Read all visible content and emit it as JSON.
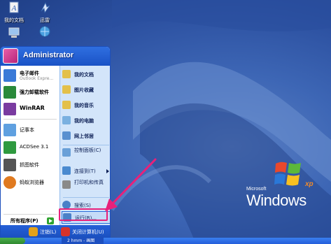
{
  "desktop": {
    "icons": [
      {
        "label": "我的文档",
        "icon": "my-documents-icon"
      },
      {
        "label": "迅雷",
        "icon": "thunder-icon"
      },
      {
        "label": "",
        "icon": "my-computer-icon"
      },
      {
        "label": "",
        "icon": "network-places-icon"
      }
    ],
    "logo": {
      "small_text": "Microsoft",
      "main_text": "Windows",
      "xp_text": "xp"
    }
  },
  "start_menu": {
    "user_name": "Administrator",
    "left_items": [
      {
        "title": "电子邮件",
        "subtitle": "Outlook Expre...",
        "icon": "email-icon",
        "color": "#3a7ad8"
      },
      {
        "title": "强力卸载软件",
        "subtitle": "",
        "icon": "uninstaller-icon",
        "color": "#2a8a3a"
      },
      {
        "title": "WinRAR",
        "subtitle": "",
        "icon": "winrar-icon",
        "color": "#7a3ba0"
      },
      {
        "title": "记事本",
        "subtitle": "",
        "icon": "notepad-icon",
        "color": "#5fa0e0"
      },
      {
        "title": "ACDSee 3.1",
        "subtitle": "",
        "icon": "acdsee-icon",
        "color": "#2f9a3f"
      },
      {
        "title": "抓图软件",
        "subtitle": "",
        "icon": "camera-icon",
        "color": "#555555"
      },
      {
        "title": "蚂蚁浏览器",
        "subtitle": "",
        "icon": "browser-icon",
        "color": "#e07a20"
      }
    ],
    "all_programs": "所有程序(P)",
    "right_items": [
      {
        "label": "我的文档",
        "icon": "my-documents-icon",
        "color": "#e3c04a",
        "bold": true
      },
      {
        "label": "图片收藏",
        "icon": "my-pictures-icon",
        "color": "#e3c04a",
        "bold": true
      },
      {
        "label": "我的音乐",
        "icon": "my-music-icon",
        "color": "#e3c04a",
        "bold": true
      },
      {
        "label": "我的电脑",
        "icon": "my-computer-icon",
        "color": "#7ab0e0",
        "bold": true
      },
      {
        "label": "网上邻居",
        "icon": "network-places-icon",
        "color": "#5a90d0",
        "bold": true
      },
      {
        "label": "控制面板(C)",
        "icon": "control-panel-icon",
        "color": "#6aa0d8",
        "bold": false
      },
      {
        "label": "连接到(T)",
        "icon": "connect-to-icon",
        "color": "#4a8ad0",
        "bold": false
      },
      {
        "label": "打印机和传真",
        "icon": "printer-icon",
        "color": "#8a8a8a",
        "bold": false
      },
      {
        "label": "搜索(S)",
        "icon": "search-icon",
        "color": "#4a80c8",
        "bold": false
      },
      {
        "label": "运行(R)...",
        "icon": "run-icon",
        "color": "#4a80c8",
        "bold": false
      }
    ],
    "footer": {
      "logoff_label": "注销(L)",
      "shutdown_label": "关闭计算机(U)"
    }
  },
  "taskbar": {
    "task_label": "2 hmm - 画图"
  },
  "colors": {
    "annotation_arrow": "#e8217a",
    "header_blue": "#245edb"
  }
}
